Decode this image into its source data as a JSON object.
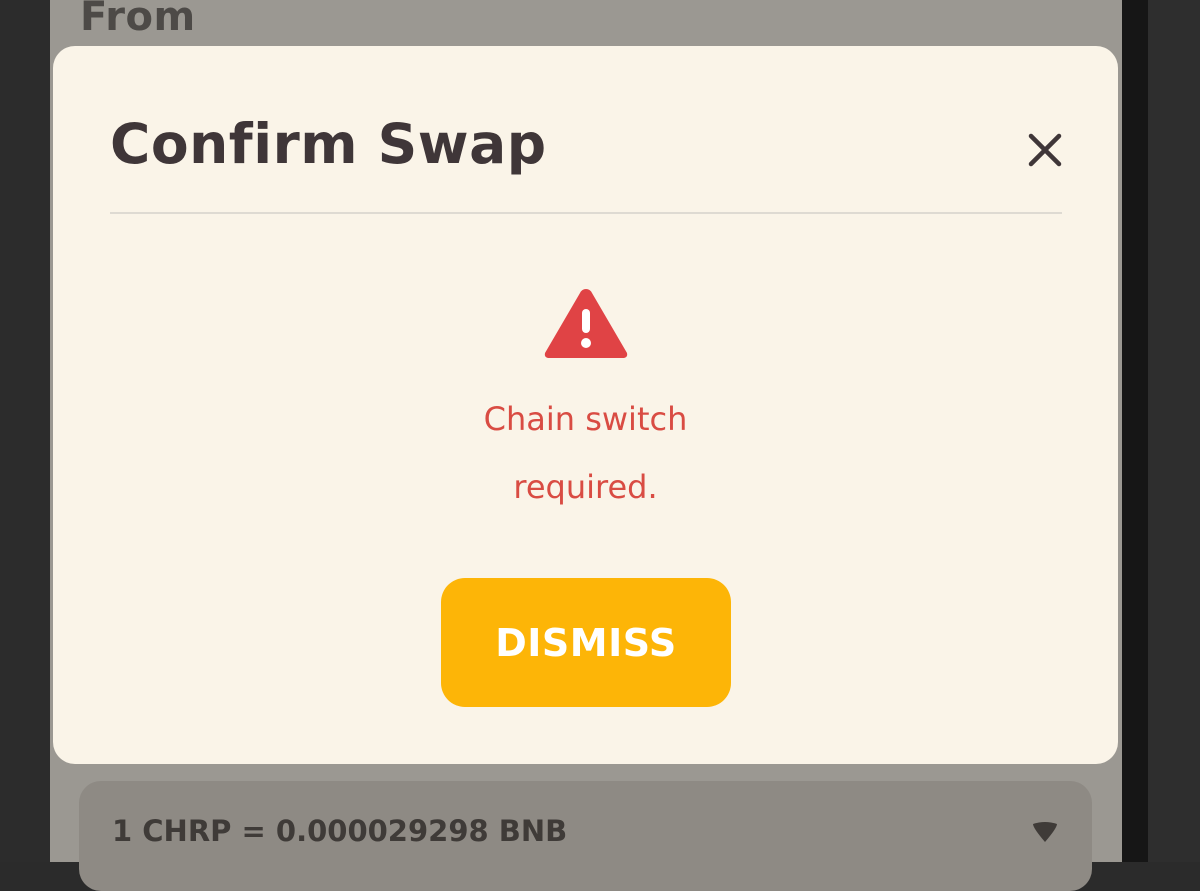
{
  "background": {
    "from_label": "From",
    "rate": {
      "text": "1 CHRP = 0.000029298 BNB",
      "toggle_icon": "caret-down-icon"
    }
  },
  "modal": {
    "title": "Confirm Swap",
    "close_icon": "close-icon",
    "warning_icon": "warning-triangle-icon",
    "error_line_1": "Chain switch",
    "error_line_2": "required.",
    "dismiss_label": "DISMISS"
  },
  "colors": {
    "accent": "#fdb507",
    "error": "#d94c43",
    "modal_bg": "#faf4e8",
    "title": "#3f3638",
    "overlay": "#9b9892"
  }
}
